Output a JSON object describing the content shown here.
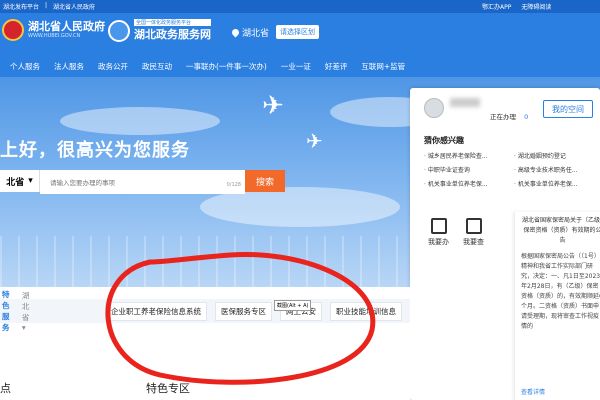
{
  "topbar": {
    "left_links": [
      "湖北发布平台",
      "湖北省人民政府"
    ],
    "right_links": [
      "鄂汇办APP",
      "无障碍阅读"
    ]
  },
  "header": {
    "gov_title": "湖北省人民政府",
    "gov_sub": "WWW.HUBEI.GOV.CN",
    "portal_tag": "全国一体化政务服务平台",
    "portal_title": "湖北政务服务网",
    "location": "湖北省",
    "region_button": "请选择区划"
  },
  "nav": {
    "items": [
      "个人服务",
      "法人服务",
      "政务公开",
      "政民互动",
      "一事联办(一件事一次办)",
      "一业一证",
      "好差评",
      "互联网+监管"
    ]
  },
  "hero": {
    "welcome": "上好，很高兴为您服务",
    "search": {
      "region": "北省",
      "placeholder": "请输入您要办理的事项",
      "counter": "0/128",
      "button": "搜索"
    }
  },
  "panel": {
    "status_label": "正在办理",
    "status_count": "0",
    "my_space": "我的空间",
    "guess_title": "猜你感兴趣",
    "items": [
      "城乡居民养老保险查...",
      "湖北婚姻预约登记",
      "中职毕业证查询",
      "高级专业技术职务任...",
      "机关事业单位养老保...",
      "机关事业单位养老保..."
    ],
    "actions": [
      "我要办",
      "我要查"
    ],
    "notice": {
      "title": "湖北省国家保密局关于（乙级）保密资格（资质）有效期的公告",
      "body": "根据国家保密局公告（（1号）精神和我省工作实际部门研究，决定：一、凡1日至2023年2月28日，有（乙级）保密资格（资质）的，有效期顺延6个月。二资格（资质）书面申请受理期，现将审查工作视疫情的",
      "more": "查看详情"
    }
  },
  "services": {
    "label": "特色服务",
    "province": "湖北省",
    "links": [
      "企业职工养老保险信息系统",
      "医保服务专区",
      "网上公安",
      "职业技能培训信息"
    ],
    "tooltip": "截图(Alt + A)"
  },
  "section_titles": [
    "点",
    "特色专区"
  ],
  "colors": {
    "brand_blue": "#2b7fe0",
    "search_orange": "#f26a2a",
    "annotation_red": "#e8241c"
  }
}
